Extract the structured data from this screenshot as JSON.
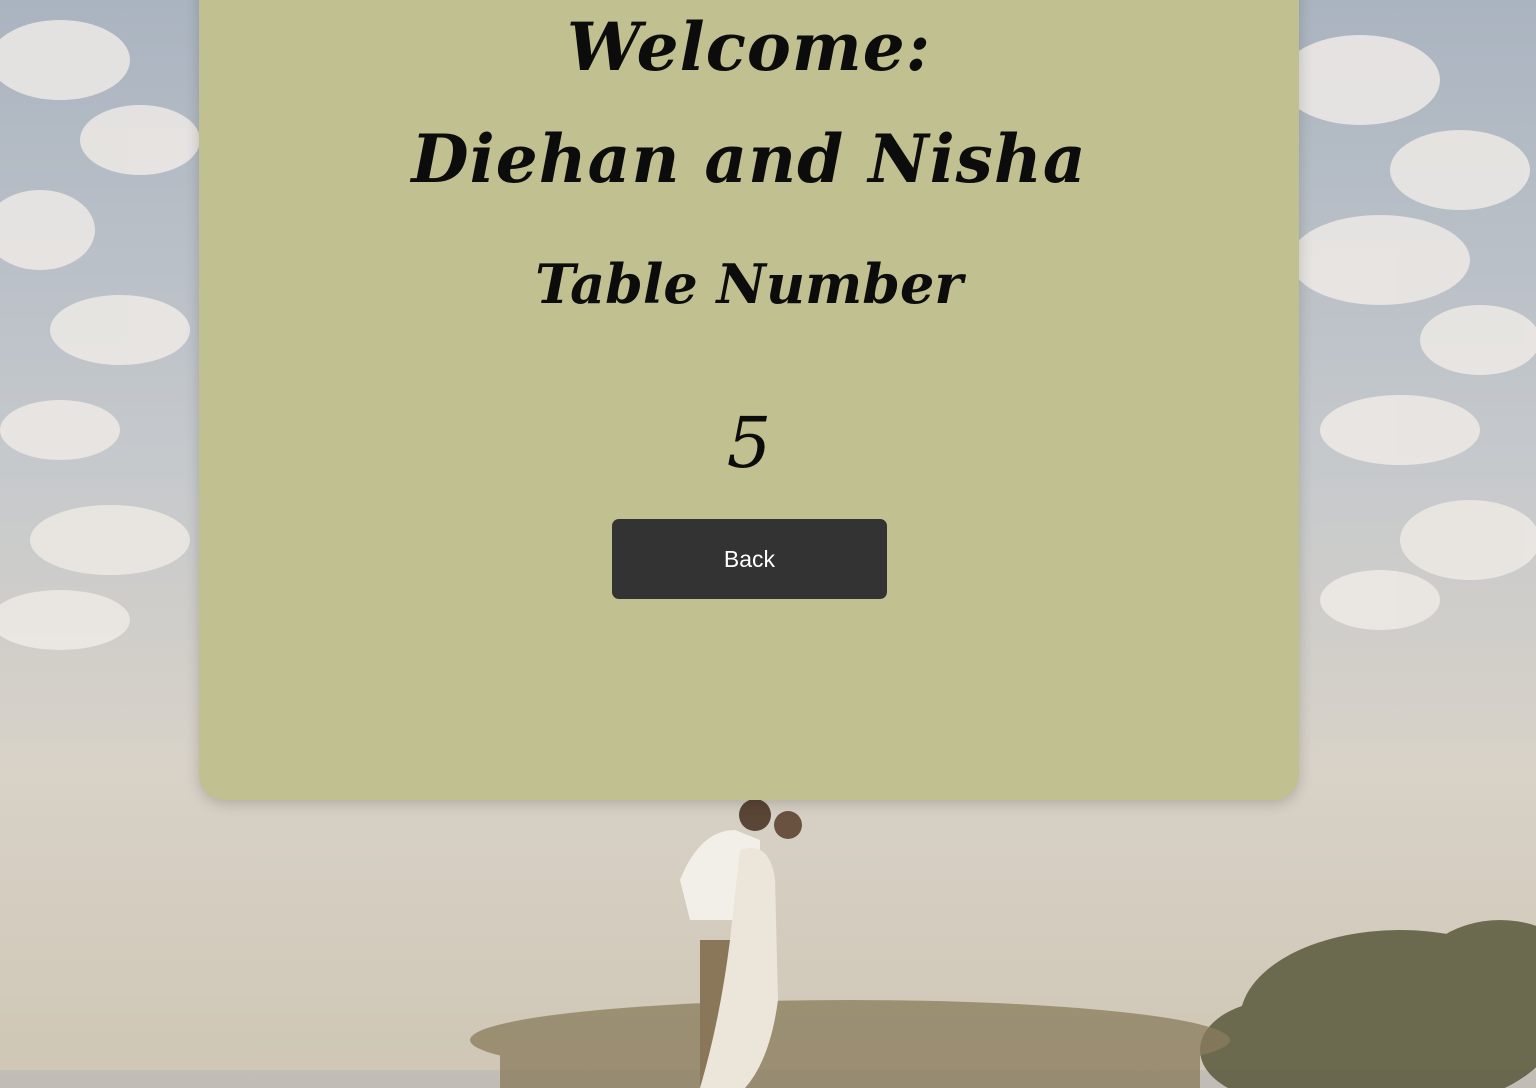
{
  "card": {
    "welcome_text": "Welcome:",
    "guest_names": "Diehan and Nisha",
    "table_label": "Table Number",
    "table_number": "5",
    "back_label": "Back"
  },
  "colors": {
    "card_background": "#c0c090",
    "button_background": "#333333",
    "button_text": "#ffffff"
  },
  "background_image": "couple-embracing-on-hill-photo"
}
